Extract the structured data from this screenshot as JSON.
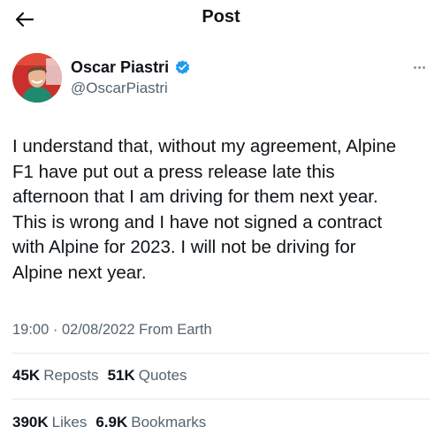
{
  "header": {
    "back_icon": "arrow-left-icon",
    "title": "Post"
  },
  "author": {
    "display_name": "Oscar Piastri",
    "handle": "@OscarPiastri",
    "verified_icon": "verified-badge-icon",
    "verified_color": "#1d9bf0",
    "more_icon": "more-options-icon"
  },
  "post": {
    "text": "I understand that, without my agreement, Alpine\nF1 have put out a press release late this\nafternoon that I am driving for them next year.\nThis is wrong and I have not signed a contract\nwith Alpine for 2023. I will not be driving for\nAlpine next year.",
    "time": "19:00",
    "separator": "·",
    "date": "02/08/2022",
    "source": "From Earth"
  },
  "stats": {
    "reposts_count": "45K",
    "reposts_label": "Reposts",
    "quotes_count": "51K",
    "quotes_label": "Quotes",
    "likes_count": "390K",
    "likes_label": "Likes",
    "bookmarks_count": "6.9K",
    "bookmarks_label": "Bookmarks"
  },
  "colors": {
    "text": "#0f1419",
    "secondary": "#536471",
    "divider": "#e6e9ec",
    "accent": "#1d9bf0"
  }
}
